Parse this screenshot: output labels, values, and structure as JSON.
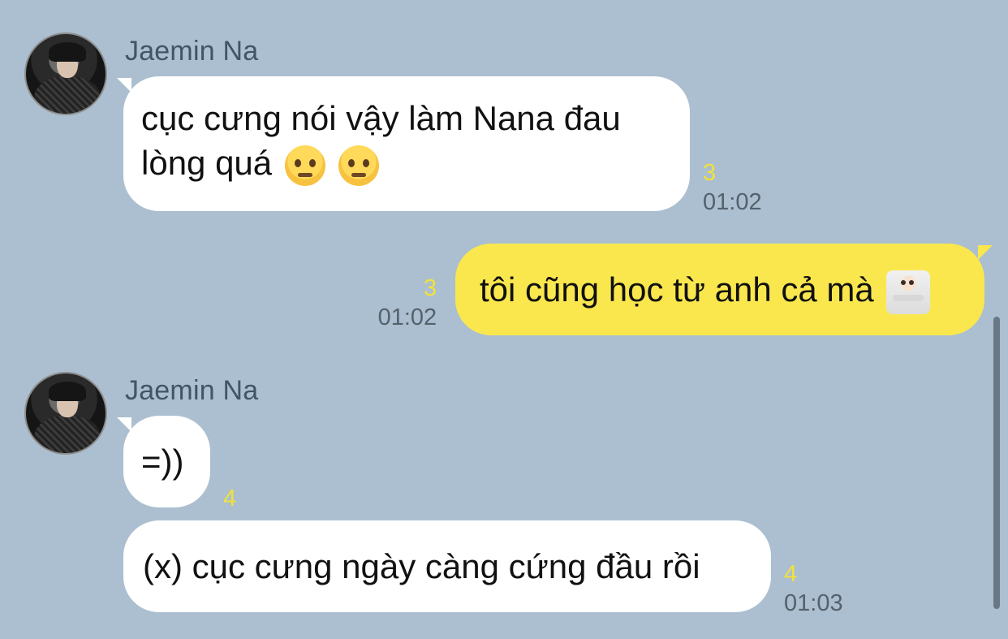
{
  "messages": [
    {
      "sender": "Jaemin Na",
      "text_lines": [
        "cục cưng nói vậy làm Nana đau",
        "lòng quá"
      ],
      "emojis": [
        "pleading-face-icon",
        "pensive-face-icon"
      ],
      "count": "3",
      "time": "01:02"
    },
    {
      "text": "tôi cũng học từ anh cả mà",
      "emojis": [
        "person-shrugging-icon"
      ],
      "count": "3",
      "time": "01:02"
    },
    {
      "sender": "Jaemin Na",
      "text": "=))",
      "count": "4"
    },
    {
      "text": "(x) cục cưng ngày càng cứng đầu rồi",
      "count": "4",
      "time": "01:03"
    }
  ],
  "colors": {
    "background": "#abbfd0",
    "incoming_bubble": "#ffffff",
    "outgoing_bubble": "#fae74e",
    "read_count": "#f2e13a",
    "timestamp": "#55616d",
    "sender_name": "#425466"
  }
}
